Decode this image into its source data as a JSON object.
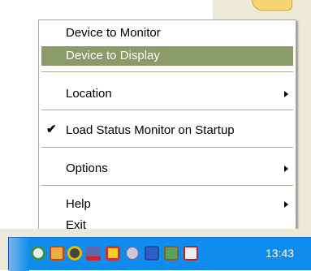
{
  "menu": {
    "items": [
      {
        "label": "Device to Monitor",
        "selected": false
      },
      {
        "label": "Device to Display",
        "selected": true
      },
      {
        "label": "Location",
        "has_submenu": true
      },
      {
        "label": "Load Status Monitor on Startup",
        "checked": true
      },
      {
        "label": "Options",
        "has_submenu": true
      },
      {
        "label": "Help",
        "has_submenu": true
      },
      {
        "label": "Exit"
      }
    ],
    "selected_color": "#8a9a69"
  },
  "taskbar": {
    "clock": "13:43",
    "tray_color": "#0f8cee",
    "tray_icons": [
      "status-monitor-icon",
      "clock-app-icon",
      "warning-icon",
      "network-error-icon",
      "security-alert-icon",
      "app-icon",
      "display-icon",
      "connection-icon",
      "wireless-disconnected-icon"
    ]
  }
}
